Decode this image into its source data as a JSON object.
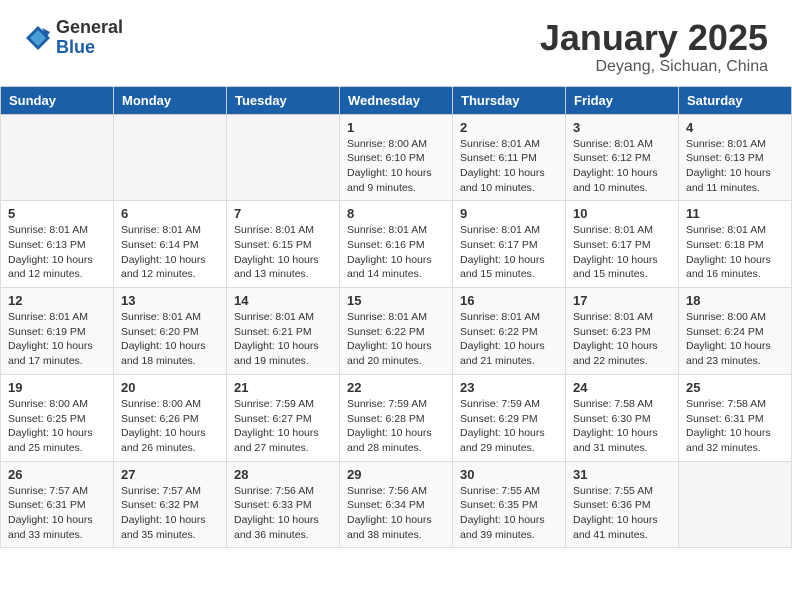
{
  "header": {
    "logo_general": "General",
    "logo_blue": "Blue",
    "title": "January 2025",
    "location": "Deyang, Sichuan, China"
  },
  "weekdays": [
    "Sunday",
    "Monday",
    "Tuesday",
    "Wednesday",
    "Thursday",
    "Friday",
    "Saturday"
  ],
  "weeks": [
    [
      {
        "day": "",
        "info": ""
      },
      {
        "day": "",
        "info": ""
      },
      {
        "day": "",
        "info": ""
      },
      {
        "day": "1",
        "info": "Sunrise: 8:00 AM\nSunset: 6:10 PM\nDaylight: 10 hours\nand 9 minutes."
      },
      {
        "day": "2",
        "info": "Sunrise: 8:01 AM\nSunset: 6:11 PM\nDaylight: 10 hours\nand 10 minutes."
      },
      {
        "day": "3",
        "info": "Sunrise: 8:01 AM\nSunset: 6:12 PM\nDaylight: 10 hours\nand 10 minutes."
      },
      {
        "day": "4",
        "info": "Sunrise: 8:01 AM\nSunset: 6:13 PM\nDaylight: 10 hours\nand 11 minutes."
      }
    ],
    [
      {
        "day": "5",
        "info": "Sunrise: 8:01 AM\nSunset: 6:13 PM\nDaylight: 10 hours\nand 12 minutes."
      },
      {
        "day": "6",
        "info": "Sunrise: 8:01 AM\nSunset: 6:14 PM\nDaylight: 10 hours\nand 12 minutes."
      },
      {
        "day": "7",
        "info": "Sunrise: 8:01 AM\nSunset: 6:15 PM\nDaylight: 10 hours\nand 13 minutes."
      },
      {
        "day": "8",
        "info": "Sunrise: 8:01 AM\nSunset: 6:16 PM\nDaylight: 10 hours\nand 14 minutes."
      },
      {
        "day": "9",
        "info": "Sunrise: 8:01 AM\nSunset: 6:17 PM\nDaylight: 10 hours\nand 15 minutes."
      },
      {
        "day": "10",
        "info": "Sunrise: 8:01 AM\nSunset: 6:17 PM\nDaylight: 10 hours\nand 15 minutes."
      },
      {
        "day": "11",
        "info": "Sunrise: 8:01 AM\nSunset: 6:18 PM\nDaylight: 10 hours\nand 16 minutes."
      }
    ],
    [
      {
        "day": "12",
        "info": "Sunrise: 8:01 AM\nSunset: 6:19 PM\nDaylight: 10 hours\nand 17 minutes."
      },
      {
        "day": "13",
        "info": "Sunrise: 8:01 AM\nSunset: 6:20 PM\nDaylight: 10 hours\nand 18 minutes."
      },
      {
        "day": "14",
        "info": "Sunrise: 8:01 AM\nSunset: 6:21 PM\nDaylight: 10 hours\nand 19 minutes."
      },
      {
        "day": "15",
        "info": "Sunrise: 8:01 AM\nSunset: 6:22 PM\nDaylight: 10 hours\nand 20 minutes."
      },
      {
        "day": "16",
        "info": "Sunrise: 8:01 AM\nSunset: 6:22 PM\nDaylight: 10 hours\nand 21 minutes."
      },
      {
        "day": "17",
        "info": "Sunrise: 8:01 AM\nSunset: 6:23 PM\nDaylight: 10 hours\nand 22 minutes."
      },
      {
        "day": "18",
        "info": "Sunrise: 8:00 AM\nSunset: 6:24 PM\nDaylight: 10 hours\nand 23 minutes."
      }
    ],
    [
      {
        "day": "19",
        "info": "Sunrise: 8:00 AM\nSunset: 6:25 PM\nDaylight: 10 hours\nand 25 minutes."
      },
      {
        "day": "20",
        "info": "Sunrise: 8:00 AM\nSunset: 6:26 PM\nDaylight: 10 hours\nand 26 minutes."
      },
      {
        "day": "21",
        "info": "Sunrise: 7:59 AM\nSunset: 6:27 PM\nDaylight: 10 hours\nand 27 minutes."
      },
      {
        "day": "22",
        "info": "Sunrise: 7:59 AM\nSunset: 6:28 PM\nDaylight: 10 hours\nand 28 minutes."
      },
      {
        "day": "23",
        "info": "Sunrise: 7:59 AM\nSunset: 6:29 PM\nDaylight: 10 hours\nand 29 minutes."
      },
      {
        "day": "24",
        "info": "Sunrise: 7:58 AM\nSunset: 6:30 PM\nDaylight: 10 hours\nand 31 minutes."
      },
      {
        "day": "25",
        "info": "Sunrise: 7:58 AM\nSunset: 6:31 PM\nDaylight: 10 hours\nand 32 minutes."
      }
    ],
    [
      {
        "day": "26",
        "info": "Sunrise: 7:57 AM\nSunset: 6:31 PM\nDaylight: 10 hours\nand 33 minutes."
      },
      {
        "day": "27",
        "info": "Sunrise: 7:57 AM\nSunset: 6:32 PM\nDaylight: 10 hours\nand 35 minutes."
      },
      {
        "day": "28",
        "info": "Sunrise: 7:56 AM\nSunset: 6:33 PM\nDaylight: 10 hours\nand 36 minutes."
      },
      {
        "day": "29",
        "info": "Sunrise: 7:56 AM\nSunset: 6:34 PM\nDaylight: 10 hours\nand 38 minutes."
      },
      {
        "day": "30",
        "info": "Sunrise: 7:55 AM\nSunset: 6:35 PM\nDaylight: 10 hours\nand 39 minutes."
      },
      {
        "day": "31",
        "info": "Sunrise: 7:55 AM\nSunset: 6:36 PM\nDaylight: 10 hours\nand 41 minutes."
      },
      {
        "day": "",
        "info": ""
      }
    ]
  ]
}
